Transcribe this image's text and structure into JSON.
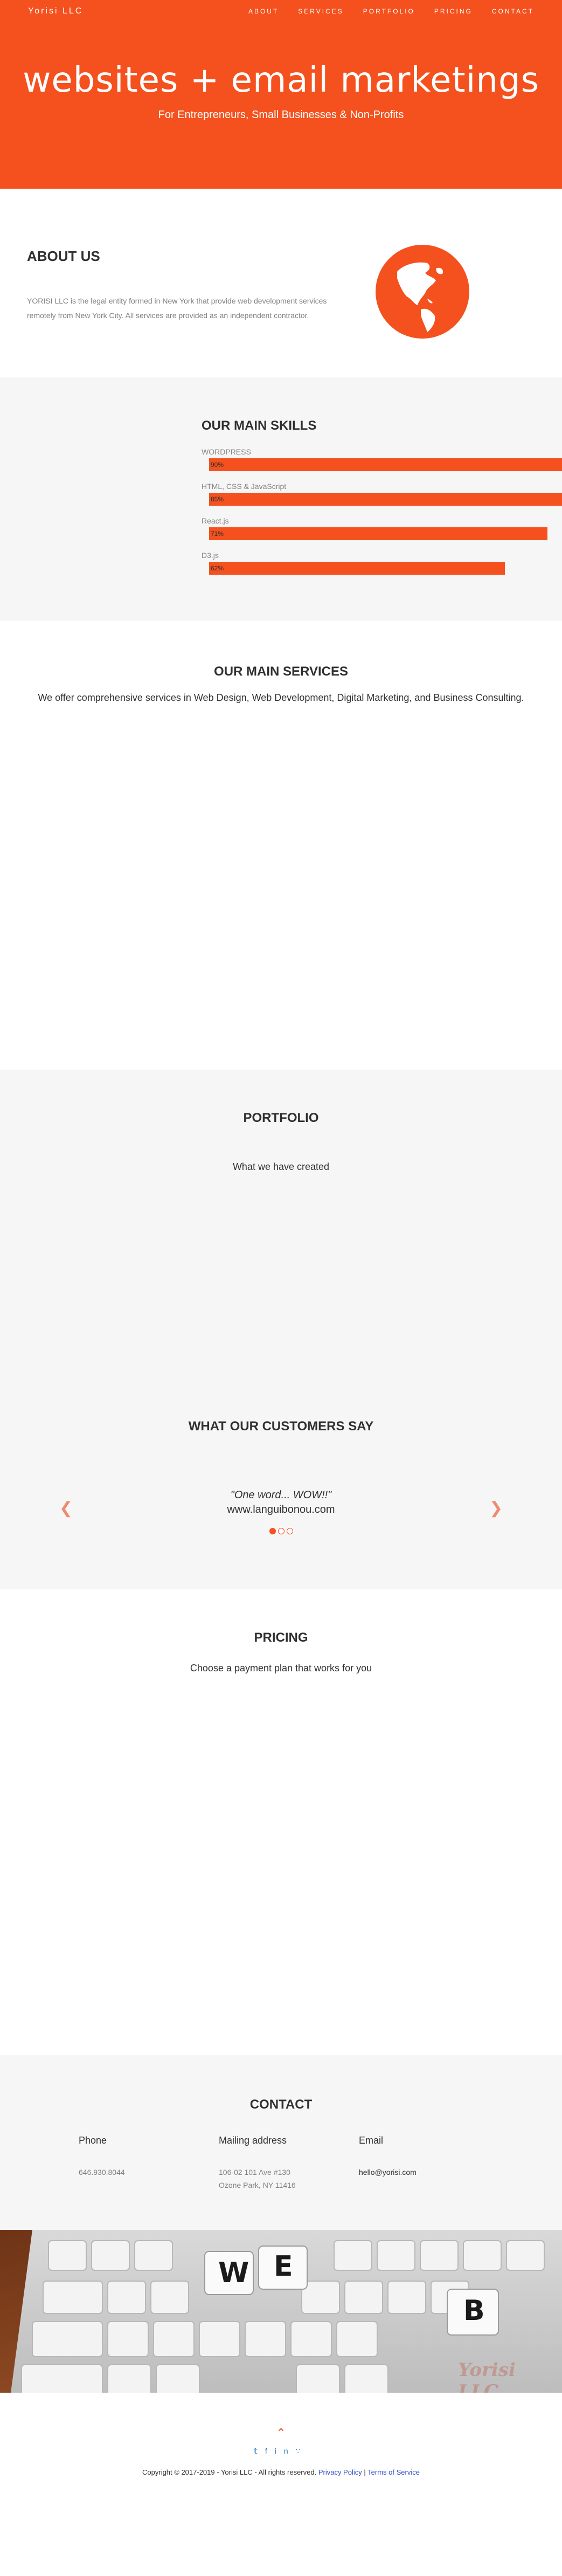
{
  "header": {
    "brand": "Yorisi LLC",
    "nav": [
      "ABOUT",
      "SERVICES",
      "PORTFOLIO",
      "PRICING",
      "CONTACT"
    ]
  },
  "hero": {
    "title": "websites + email marketings",
    "subtitle": "For Entrepreneurs, Small Businesses & Non-Profits"
  },
  "about": {
    "title": "ABOUT US",
    "text": "YORISI LLC is the legal entity formed in New York that provide web development services remotely from New York City. All services are provided as an independent contractor."
  },
  "skills": {
    "title": "OUR MAIN SKILLS",
    "items": [
      {
        "label": "WORDPRESS",
        "percent_text": "90%",
        "value": 90
      },
      {
        "label": "HTML, CSS & JavaScript",
        "percent_text": "85%",
        "value": 85
      },
      {
        "label": "React.js",
        "percent_text": "71%",
        "value": 71
      },
      {
        "label": "D3.js",
        "percent_text": "62%",
        "value": 62
      }
    ]
  },
  "chart_data": {
    "type": "bar",
    "title": "OUR MAIN SKILLS",
    "categories": [
      "WORDPRESS",
      "HTML, CSS & JavaScript",
      "React.js",
      "D3.js"
    ],
    "values": [
      90,
      85,
      71,
      62
    ],
    "ylim": [
      0,
      100
    ]
  },
  "services": {
    "title": "OUR MAIN SERVICES",
    "text": "We offer comprehensive services in Web Design, Web Development, Digital Marketing, and Business Consulting."
  },
  "portfolio": {
    "title": "PORTFOLIO",
    "subtitle": "What we have created"
  },
  "testimonials": {
    "title": "WHAT OUR CUSTOMERS SAY",
    "quote": "\"One word... WOW!!\"",
    "author": "www.languibonou.com",
    "prev_icon": "chevron-left-icon",
    "next_icon": "chevron-right-icon",
    "active_dot": 0,
    "dot_count": 3
  },
  "pricing": {
    "title": "PRICING",
    "subtitle": "Choose a payment plan that works for you"
  },
  "contact": {
    "title": "CONTACT",
    "phone_label": "Phone",
    "phone_value": "646.930.8044",
    "mail_label": "Mailing address",
    "mail_line1": "106-02 101 Ave #130",
    "mail_line2": "Ozone Park, NY 11416",
    "email_label": "Email",
    "email_value": "hello@yorisi.com"
  },
  "banner": {
    "keys": [
      "W",
      "E",
      "B"
    ],
    "watermark": "Yorisi LLC"
  },
  "footer": {
    "top_icon": "chevron-up-icon",
    "social_icons": [
      "twitter-icon",
      "facebook-icon",
      "linkedin-icon",
      "share-icon"
    ],
    "copyright": "Copyright © 2017-2019 - Yorisi LLC - All rights reserved.",
    "privacy": "Privacy Policy",
    "separator": "|",
    "terms": "Terms of Service"
  },
  "colors": {
    "accent": "#f4511e",
    "gray_bg": "#f6f6f6",
    "link": "#2a4ec8"
  }
}
